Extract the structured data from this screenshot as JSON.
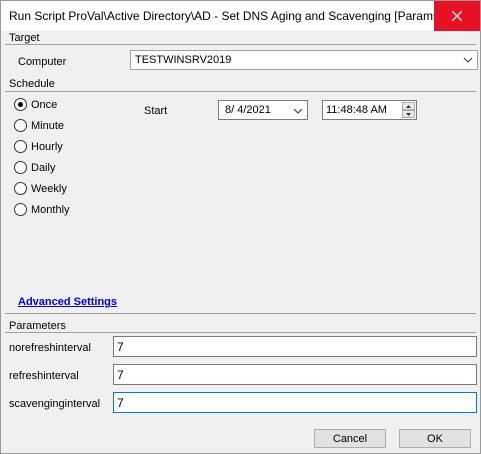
{
  "window": {
    "title": "Run Script ProVal\\Active Directory\\AD - Set DNS Aging and Scavenging [Params]"
  },
  "target": {
    "section_label": "Target",
    "computer_label": "Computer",
    "computer_value": "TESTWINSRV2019"
  },
  "schedule": {
    "section_label": "Schedule",
    "options": [
      {
        "label": "Once",
        "checked": true
      },
      {
        "label": "Minute",
        "checked": false
      },
      {
        "label": "Hourly",
        "checked": false
      },
      {
        "label": "Daily",
        "checked": false
      },
      {
        "label": "Weekly",
        "checked": false
      },
      {
        "label": "Monthly",
        "checked": false
      }
    ],
    "start_label": "Start",
    "start_date": "8/  4/2021",
    "start_time": "11:48:48 AM",
    "advanced_link": "Advanced Settings"
  },
  "parameters": {
    "section_label": "Parameters",
    "fields": [
      {
        "label": "norefreshinterval",
        "value": "7"
      },
      {
        "label": "refreshinterval",
        "value": "7"
      },
      {
        "label": "scavenginginterval",
        "value": "7"
      }
    ]
  },
  "buttons": {
    "cancel": "Cancel",
    "ok": "OK"
  }
}
